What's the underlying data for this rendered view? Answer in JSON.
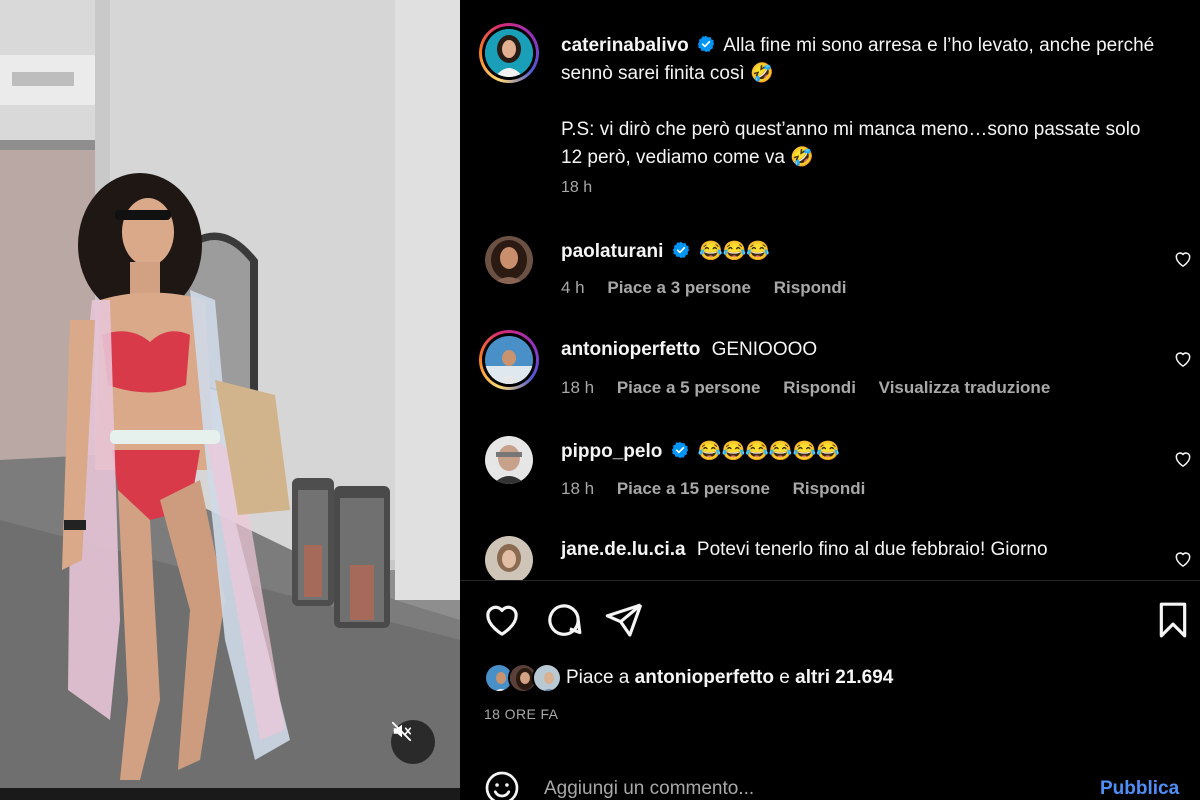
{
  "post": {
    "author": "caterinabalivo",
    "caption_line1": "Alla fine mi sono arresa e l’ho levato, anche perché sennò sarei finita così 🤣",
    "caption_line2": "P.S: vi dirò che però quest’anno mi manca meno…sono passate solo 12 però, vediamo come va 🤣",
    "time": "18 h"
  },
  "comments": [
    {
      "user": "paolaturani",
      "verified": true,
      "text": "😂😂😂",
      "time": "4 h",
      "likes": "Piace a 3 persone",
      "reply": "Rispondi",
      "translate": ""
    },
    {
      "user": "antonioperfetto",
      "verified": false,
      "text": "GENIOOOO",
      "time": "18 h",
      "likes": "Piace a 5 persone",
      "reply": "Rispondi",
      "translate": "Visualizza traduzione"
    },
    {
      "user": "pippo_pelo",
      "verified": true,
      "text": "😂😂😂😂😂😂",
      "time": "18 h",
      "likes": "Piace a 15 persone",
      "reply": "Rispondi",
      "translate": ""
    },
    {
      "user": "jane.de.lu.ci.a",
      "verified": false,
      "text": "Potevi tenerlo fino al due febbraio! Giorno",
      "time": "",
      "likes": "",
      "reply": "",
      "translate": ""
    }
  ],
  "likes": {
    "prefix": "Piace a",
    "user": "antonioperfetto",
    "connector": "e",
    "others": "altri 21.694"
  },
  "date_label": "18 ORE FA",
  "composer": {
    "placeholder": "Aggiungi un commento...",
    "publish_label": "Pubblica"
  },
  "icons": {
    "like": "heart-icon",
    "comment": "comment-icon",
    "share": "share-icon",
    "save": "bookmark-icon",
    "mute": "speaker-muted-icon",
    "emoji": "emoji-icon",
    "verified": "verified-badge-icon"
  },
  "colors": {
    "background": "#000000",
    "text": "#f5f5f5",
    "secondary": "#a8a8a8",
    "verified": "#0095f6",
    "link": "#4f8ef7"
  }
}
